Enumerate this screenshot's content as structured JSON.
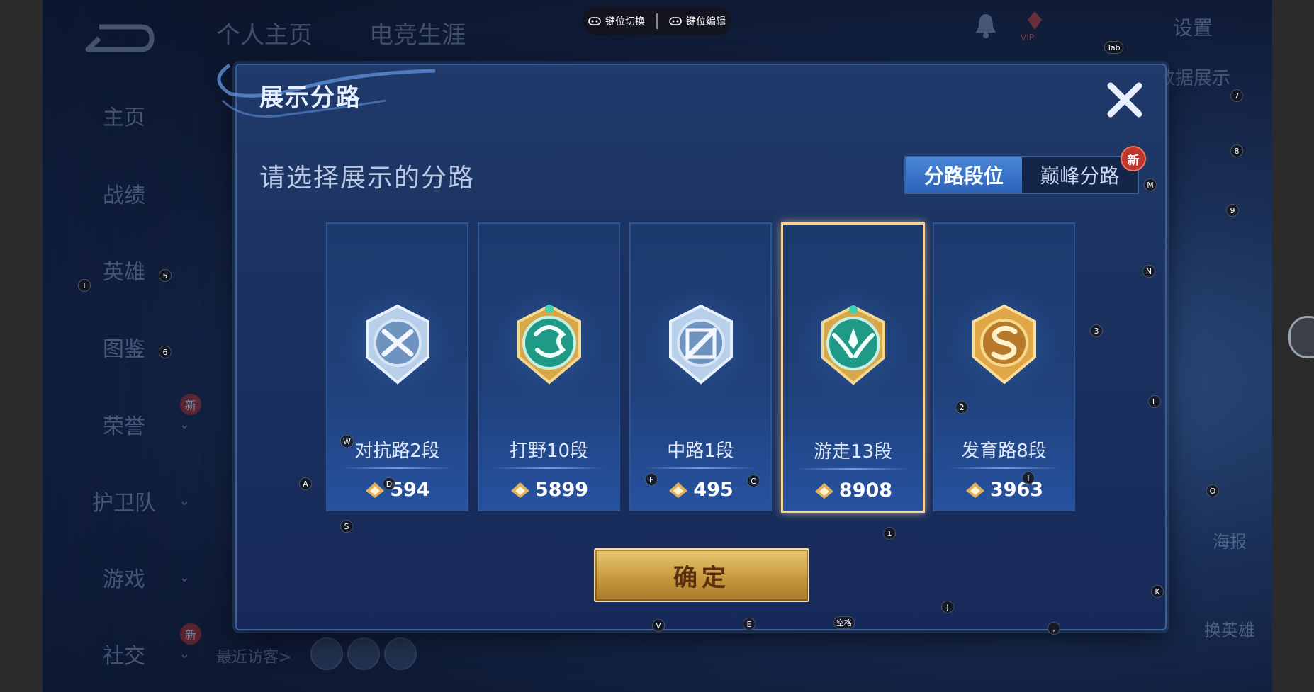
{
  "background": {
    "top_tabs": [
      "个人主页",
      "电竞生涯"
    ],
    "sidebar": [
      {
        "label": "主页",
        "chevron": false,
        "new": false
      },
      {
        "label": "战绩",
        "chevron": false,
        "new": false
      },
      {
        "label": "英雄",
        "chevron": false,
        "new": false
      },
      {
        "label": "图鉴",
        "chevron": false,
        "new": false
      },
      {
        "label": "荣誉",
        "chevron": true,
        "new": true
      },
      {
        "label": "护卫队",
        "chevron": true,
        "new": false
      },
      {
        "label": "游戏",
        "chevron": true,
        "new": false
      },
      {
        "label": "社交",
        "chevron": true,
        "new": true
      }
    ],
    "new_badge": "新",
    "settings": "设置",
    "data_display": "定和数据展示",
    "poster": "海报",
    "change_hero": "换英雄",
    "recent_visitors": "最近访客>",
    "vip": "VIP"
  },
  "keybar": {
    "switch_label": "键位切换",
    "edit_label": "键位编辑"
  },
  "modal": {
    "title": "展示分路",
    "subtitle": "请选择展示的分路",
    "tabs": [
      {
        "label": "分路段位",
        "active": true
      },
      {
        "label": "巅峰分路",
        "active": false,
        "badge": "新"
      }
    ],
    "lanes": [
      {
        "name": "对抗路2段",
        "score": "594",
        "emblem": "clash-lane-emblem-icon",
        "color": "#9fc3e6",
        "selected": false
      },
      {
        "name": "打野10段",
        "score": "5899",
        "emblem": "jungle-emblem-icon",
        "color": "#1f9a86",
        "selected": false
      },
      {
        "name": "中路1段",
        "score": "495",
        "emblem": "mid-lane-emblem-icon",
        "color": "#9fc3e6",
        "selected": false
      },
      {
        "name": "游走13段",
        "score": "8908",
        "emblem": "roam-emblem-icon",
        "color": "#1f9a86",
        "selected": true
      },
      {
        "name": "发育路8段",
        "score": "3963",
        "emblem": "farm-lane-emblem-icon",
        "color": "#e0a648",
        "selected": false
      }
    ],
    "confirm": "确定"
  },
  "key_hints": [
    "Tab",
    "7",
    "8",
    "M",
    "9",
    "N",
    "3",
    "5",
    "T",
    "6",
    "W",
    "A",
    "D",
    "F",
    "C",
    "I",
    "2",
    "L",
    "O",
    "S",
    "1",
    "K",
    "J",
    "V",
    "E",
    "空格",
    ","
  ]
}
